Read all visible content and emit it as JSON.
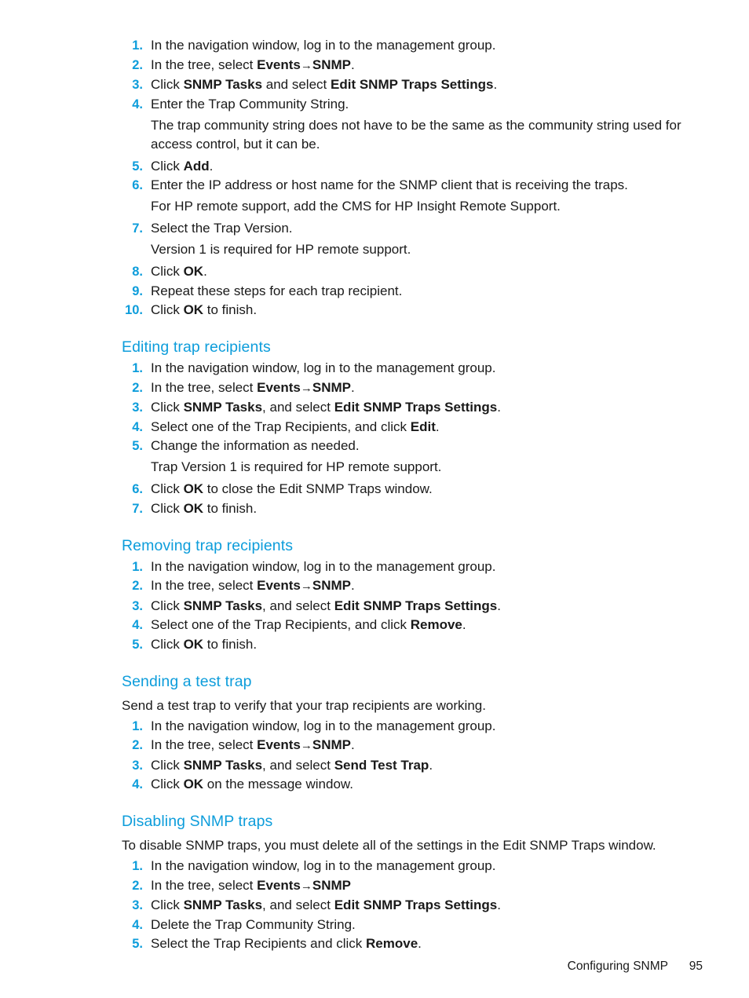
{
  "page": {
    "footer_chapter": "Configuring SNMP",
    "footer_page_number": "95",
    "accent_color": "#0d9ddb",
    "text_color": "#1a1a1a",
    "background_color": "#ffffff"
  },
  "sections": [
    {
      "id": "adding-trap-recipients",
      "heading": "",
      "steps": [
        {
          "num": "1.",
          "parts": [
            {
              "t": "In the navigation window, log in to the management group."
            }
          ]
        },
        {
          "num": "2.",
          "parts": [
            {
              "t": "In the tree, select "
            },
            {
              "t": "Events",
              "b": true
            },
            {
              "t": "→",
              "arrow": true
            },
            {
              "t": "SNMP",
              "b": true
            },
            {
              "t": "."
            }
          ]
        },
        {
          "num": "3.",
          "parts": [
            {
              "t": "Click "
            },
            {
              "t": "SNMP Tasks",
              "b": true
            },
            {
              "t": " and select "
            },
            {
              "t": "Edit SNMP Traps Settings",
              "b": true
            },
            {
              "t": "."
            }
          ]
        },
        {
          "num": "4.",
          "parts": [
            {
              "t": "Enter the Trap Community String."
            }
          ],
          "note": "The trap community string does not have to be the same as the community string used for access control, but it can be."
        },
        {
          "num": "5.",
          "parts": [
            {
              "t": "Click "
            },
            {
              "t": "Add",
              "b": true
            },
            {
              "t": "."
            }
          ]
        },
        {
          "num": "6.",
          "parts": [
            {
              "t": "Enter the IP address or host name for the SNMP client that is receiving the traps."
            }
          ],
          "note": "For HP remote support, add the CMS for HP Insight Remote Support."
        },
        {
          "num": "7.",
          "parts": [
            {
              "t": "Select the Trap Version."
            }
          ],
          "note": "Version 1 is required for HP remote support."
        },
        {
          "num": "8.",
          "parts": [
            {
              "t": "Click "
            },
            {
              "t": "OK",
              "b": true
            },
            {
              "t": "."
            }
          ]
        },
        {
          "num": "9.",
          "parts": [
            {
              "t": "Repeat these steps for each trap recipient."
            }
          ]
        },
        {
          "num": "10.",
          "parts": [
            {
              "t": "Click "
            },
            {
              "t": "OK",
              "b": true
            },
            {
              "t": " to finish."
            }
          ]
        }
      ]
    },
    {
      "id": "editing-trap-recipients",
      "heading": "Editing trap recipients",
      "steps": [
        {
          "num": "1.",
          "parts": [
            {
              "t": "In the navigation window, log in to the management group."
            }
          ]
        },
        {
          "num": "2.",
          "parts": [
            {
              "t": "In the tree, select "
            },
            {
              "t": "Events",
              "b": true
            },
            {
              "t": "→",
              "arrow": true
            },
            {
              "t": "SNMP",
              "b": true
            },
            {
              "t": "."
            }
          ]
        },
        {
          "num": "3.",
          "parts": [
            {
              "t": "Click "
            },
            {
              "t": "SNMP Tasks",
              "b": true
            },
            {
              "t": ", and select "
            },
            {
              "t": "Edit SNMP Traps Settings",
              "b": true
            },
            {
              "t": "."
            }
          ]
        },
        {
          "num": "4.",
          "parts": [
            {
              "t": "Select one of the Trap Recipients, and click "
            },
            {
              "t": "Edit",
              "b": true
            },
            {
              "t": "."
            }
          ]
        },
        {
          "num": "5.",
          "parts": [
            {
              "t": "Change the information as needed."
            }
          ],
          "note": "Trap Version 1 is required for HP remote support."
        },
        {
          "num": "6.",
          "parts": [
            {
              "t": "Click "
            },
            {
              "t": "OK",
              "b": true
            },
            {
              "t": " to close the Edit SNMP Traps window."
            }
          ]
        },
        {
          "num": "7.",
          "parts": [
            {
              "t": "Click "
            },
            {
              "t": "OK",
              "b": true
            },
            {
              "t": " to finish."
            }
          ]
        }
      ]
    },
    {
      "id": "removing-trap-recipients",
      "heading": "Removing trap recipients",
      "steps": [
        {
          "num": "1.",
          "parts": [
            {
              "t": "In the navigation window, log in to the management group."
            }
          ]
        },
        {
          "num": "2.",
          "parts": [
            {
              "t": "In the tree, select "
            },
            {
              "t": "Events",
              "b": true
            },
            {
              "t": "→",
              "arrow": true
            },
            {
              "t": "SNMP",
              "b": true
            },
            {
              "t": "."
            }
          ]
        },
        {
          "num": "3.",
          "parts": [
            {
              "t": "Click "
            },
            {
              "t": "SNMP Tasks",
              "b": true
            },
            {
              "t": ", and select "
            },
            {
              "t": "Edit SNMP Traps Settings",
              "b": true
            },
            {
              "t": "."
            }
          ]
        },
        {
          "num": "4.",
          "parts": [
            {
              "t": "Select one of the Trap Recipients, and click "
            },
            {
              "t": "Remove",
              "b": true
            },
            {
              "t": "."
            }
          ]
        },
        {
          "num": "5.",
          "parts": [
            {
              "t": "Click "
            },
            {
              "t": "OK",
              "b": true
            },
            {
              "t": " to finish."
            }
          ]
        }
      ]
    },
    {
      "id": "sending-a-test-trap",
      "heading": "Sending a test trap",
      "intro": "Send a test trap to verify that your trap recipients are working.",
      "steps": [
        {
          "num": "1.",
          "parts": [
            {
              "t": "In the navigation window, log in to the management group."
            }
          ]
        },
        {
          "num": "2.",
          "parts": [
            {
              "t": "In the tree, select "
            },
            {
              "t": "Events",
              "b": true
            },
            {
              "t": "→",
              "arrow": true
            },
            {
              "t": "SNMP",
              "b": true
            },
            {
              "t": "."
            }
          ]
        },
        {
          "num": "3.",
          "parts": [
            {
              "t": "Click "
            },
            {
              "t": "SNMP Tasks",
              "b": true
            },
            {
              "t": ", and select "
            },
            {
              "t": "Send Test Trap",
              "b": true
            },
            {
              "t": "."
            }
          ]
        },
        {
          "num": "4.",
          "parts": [
            {
              "t": "Click "
            },
            {
              "t": "OK",
              "b": true
            },
            {
              "t": " on the message window."
            }
          ]
        }
      ]
    },
    {
      "id": "disabling-snmp-traps",
      "heading": "Disabling SNMP traps",
      "intro": "To disable SNMP traps, you must delete all of the settings in the Edit SNMP Traps window.",
      "steps": [
        {
          "num": "1.",
          "parts": [
            {
              "t": "In the navigation window, log in to the management group."
            }
          ]
        },
        {
          "num": "2.",
          "parts": [
            {
              "t": "In the tree, select "
            },
            {
              "t": "Events",
              "b": true
            },
            {
              "t": "→",
              "arrow": true
            },
            {
              "t": "SNMP",
              "b": true
            }
          ]
        },
        {
          "num": "3.",
          "parts": [
            {
              "t": "Click "
            },
            {
              "t": "SNMP Tasks",
              "b": true
            },
            {
              "t": ", and select "
            },
            {
              "t": "Edit SNMP Traps Settings",
              "b": true
            },
            {
              "t": "."
            }
          ]
        },
        {
          "num": "4.",
          "parts": [
            {
              "t": "Delete the Trap Community String."
            }
          ]
        },
        {
          "num": "5.",
          "parts": [
            {
              "t": "Select the Trap Recipients and click "
            },
            {
              "t": "Remove",
              "b": true
            },
            {
              "t": "."
            }
          ]
        }
      ]
    }
  ]
}
